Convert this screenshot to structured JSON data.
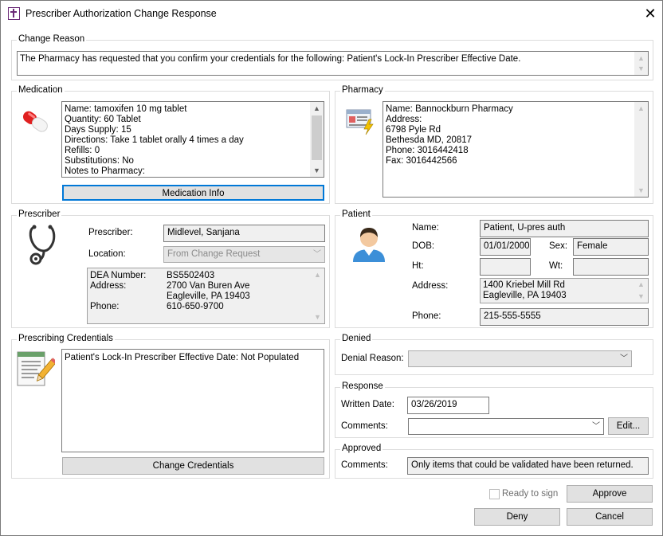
{
  "window": {
    "title": "Prescriber Authorization Change Response"
  },
  "change_reason": {
    "label": "Change Reason",
    "text": "The Pharmacy has requested that you confirm your credentials for the following: Patient's Lock-In Prescriber Effective Date."
  },
  "medication": {
    "label": "Medication",
    "lines": "Name: tamoxifen 10 mg tablet\nQuantity: 60 Tablet\nDays Supply: 15\nDirections: Take 1 tablet orally 4 times a day\nRefills: 0\nSubstitutions: No\nNotes to Pharmacy:",
    "button": "Medication Info"
  },
  "pharmacy": {
    "label": "Pharmacy",
    "lines": "Name: Bannockburn Pharmacy\nAddress:\n6798 Pyle Rd\nBethesda MD, 20817\nPhone: 3016442418\nFax: 3016442566"
  },
  "prescriber": {
    "label": "Prescriber",
    "prescriber_label": "Prescriber:",
    "prescriber_value": "Midlevel, Sanjana",
    "location_label": "Location:",
    "location_value": "From Change Request",
    "details_labels": "DEA Number:\nAddress:\n\nPhone:",
    "details_values": "BS5502403\n2700 Van Buren Ave\nEagleville, PA 19403\n610-650-9700"
  },
  "patient": {
    "label": "Patient",
    "name_label": "Name:",
    "name_value": "Patient, U-pres auth",
    "dob_label": "DOB:",
    "dob_value": "01/01/2000",
    "sex_label": "Sex:",
    "sex_value": "Female",
    "ht_label": "Ht:",
    "ht_value": "",
    "wt_label": "Wt:",
    "wt_value": "",
    "address_label": "Address:",
    "address_value": "1400 Kriebel Mill Rd\nEagleville, PA 19403",
    "phone_label": "Phone:",
    "phone_value": "215-555-5555"
  },
  "credentials": {
    "label": "Prescribing Credentials",
    "text": "Patient's Lock-In Prescriber Effective Date: Not Populated",
    "button": "Change Credentials"
  },
  "denied": {
    "label": "Denied",
    "reason_label": "Denial Reason:",
    "reason_value": ""
  },
  "response": {
    "label": "Response",
    "written_date_label": "Written Date:",
    "written_date_value": "03/26/2019",
    "comments_label": "Comments:",
    "comments_value": "",
    "edit_button": "Edit..."
  },
  "approved": {
    "label": "Approved",
    "comments_label": "Comments:",
    "comments_value": "Only items that could be validated have been returned."
  },
  "footer": {
    "ready_to_sign": "Ready to sign",
    "approve": "Approve",
    "deny": "Deny",
    "cancel": "Cancel"
  },
  "icons": {
    "app": "medical-cross-icon",
    "medication": "pill-capsule-icon",
    "pharmacy": "pharmacy-card-icon",
    "prescriber": "stethoscope-icon",
    "patient": "patient-avatar-icon",
    "credentials": "document-pencil-icon"
  },
  "colors": {
    "focus": "#0078d7",
    "accent": "#6b2a77"
  }
}
